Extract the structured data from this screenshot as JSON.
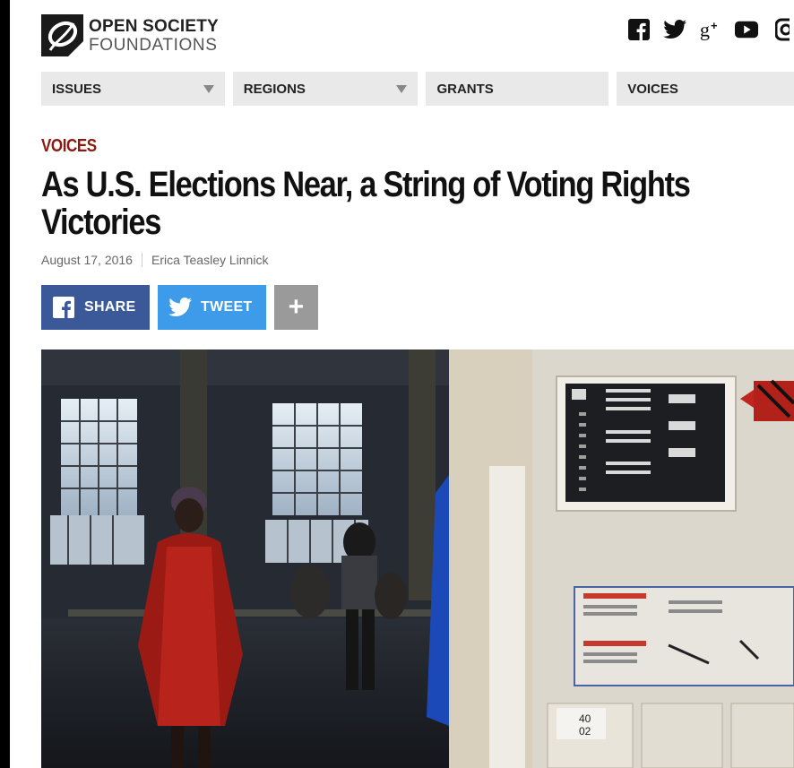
{
  "brand": {
    "line1": "OPEN SOCIETY",
    "line2": "FOUNDATIONS"
  },
  "social": {
    "icons": [
      "facebook-icon",
      "twitter-icon",
      "google-plus-icon",
      "youtube-icon",
      "instagram-icon"
    ],
    "google_plus_label": "g+"
  },
  "nav": {
    "items": [
      {
        "label": "ISSUES",
        "has_dropdown": true
      },
      {
        "label": "REGIONS",
        "has_dropdown": true
      },
      {
        "label": "GRANTS",
        "has_dropdown": false
      },
      {
        "label": "VOICES",
        "has_dropdown": false
      }
    ]
  },
  "article": {
    "kicker": "VOICES",
    "title": "As U.S. Elections Near, a String of Voting Rights Victories",
    "date": "August 17, 2016",
    "author": "Erica Teasley Linnick"
  },
  "share": {
    "facebook_label": "SHARE",
    "twitter_label": "TWEET",
    "more_label": "+"
  },
  "photo": {
    "machine_label_1": "40",
    "machine_label_2": "02"
  },
  "colors": {
    "kicker": "#8a1a12",
    "facebook": "#3b5998",
    "twitter": "#3d9be9",
    "more": "#9a9a9a",
    "nav_bg": "#e9e9e9"
  }
}
